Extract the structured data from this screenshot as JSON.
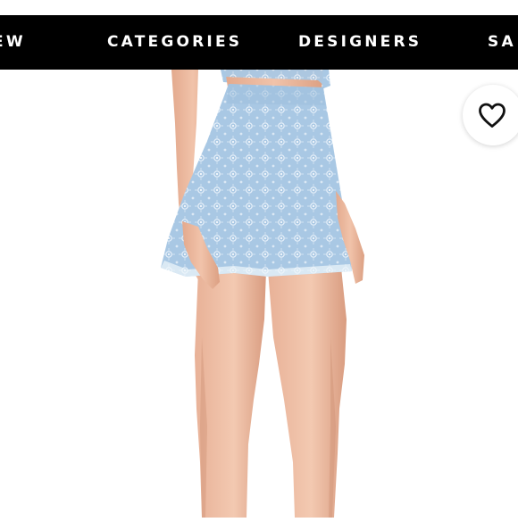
{
  "nav": {
    "items": [
      "EW",
      "CATEGORIES",
      "DESIGNERS",
      "SA"
    ]
  },
  "favorite": {
    "icon": "heart-outline-icon"
  },
  "product_image": {
    "description_icon": "product-photo"
  },
  "colors": {
    "navbar": "#000000",
    "nav_text": "#ffffff",
    "skirt": "#a9c8e4"
  }
}
